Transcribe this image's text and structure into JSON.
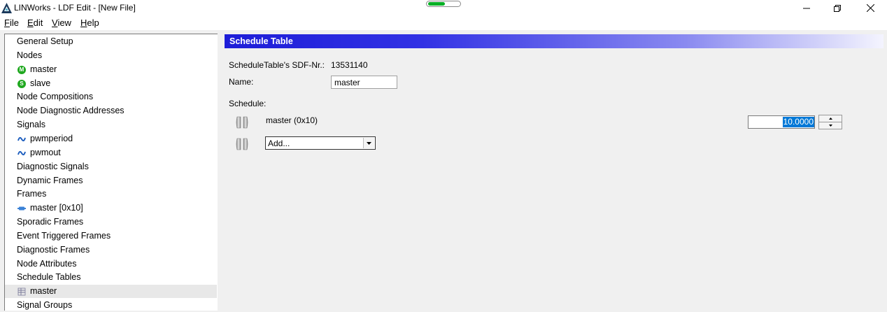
{
  "window": {
    "title": "LINWorks - LDF Edit - [New File]",
    "progress_fraction": 0.55
  },
  "menu": [
    {
      "label": "File",
      "mnemonic": "F",
      "rest": "ile"
    },
    {
      "label": "Edit",
      "mnemonic": "E",
      "rest": "dit"
    },
    {
      "label": "View",
      "mnemonic": "V",
      "rest": "iew"
    },
    {
      "label": "Help",
      "mnemonic": "H",
      "rest": "elp"
    }
  ],
  "tree": {
    "items": [
      {
        "label": "General Setup",
        "level": 0
      },
      {
        "label": "Nodes",
        "level": 0
      },
      {
        "label": "master",
        "level": 1,
        "icon": "master-node-icon",
        "badge": "M"
      },
      {
        "label": "slave",
        "level": 1,
        "icon": "slave-node-icon",
        "badge": "S"
      },
      {
        "label": "Node Compositions",
        "level": 0
      },
      {
        "label": "Node Diagnostic Addresses",
        "level": 0
      },
      {
        "label": "Signals",
        "level": 0
      },
      {
        "label": "pwmperiod",
        "level": 1,
        "icon": "signal-wave-icon"
      },
      {
        "label": "pwmout",
        "level": 1,
        "icon": "signal-wave-icon"
      },
      {
        "label": "Diagnostic Signals",
        "level": 0
      },
      {
        "label": "Dynamic Frames",
        "level": 0
      },
      {
        "label": "Frames",
        "level": 0
      },
      {
        "label": "master [0x10]",
        "level": 1,
        "icon": "frame-icon"
      },
      {
        "label": "Sporadic Frames",
        "level": 0
      },
      {
        "label": "Event Triggered Frames",
        "level": 0
      },
      {
        "label": "Diagnostic Frames",
        "level": 0
      },
      {
        "label": "Node Attributes",
        "level": 0
      },
      {
        "label": "Schedule Tables",
        "level": 0
      },
      {
        "label": "master",
        "level": 1,
        "icon": "schedule-table-icon",
        "selected": true
      },
      {
        "label": "Signal Groups",
        "level": 0
      }
    ]
  },
  "panel": {
    "title": "Schedule Table",
    "sdf_label": "ScheduleTable's SDF-Nr.:",
    "sdf_value": "13531140",
    "name_label": "Name:",
    "name_value": "master",
    "schedule_label": "Schedule:",
    "entry_label": "master (0x10)",
    "delay_value": "10.0000",
    "add_select_value": "Add..."
  },
  "colors": {
    "header_gradient_start": "#1d1dd8",
    "selection": "#0078d7",
    "node_badge": "#1fa81f",
    "signal_icon": "#1f5fbf"
  }
}
